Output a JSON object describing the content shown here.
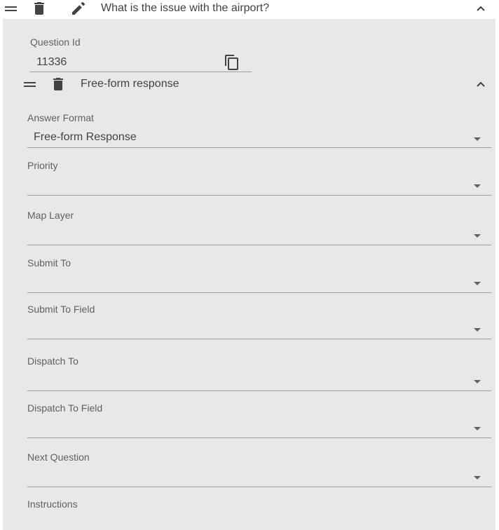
{
  "question": {
    "title": "What is the issue with the airport?",
    "question_id_label": "Question Id",
    "question_id_value": "11336"
  },
  "answer": {
    "title": "Free-form response"
  },
  "fields": {
    "answer_format": {
      "label": "Answer Format",
      "value": "Free-form Response"
    },
    "priority": {
      "label": "Priority",
      "value": ""
    },
    "map_layer": {
      "label": "Map Layer",
      "value": ""
    },
    "submit_to": {
      "label": "Submit To",
      "value": ""
    },
    "submit_to_field": {
      "label": "Submit To Field",
      "value": ""
    },
    "dispatch_to": {
      "label": "Dispatch To",
      "value": ""
    },
    "dispatch_to_field": {
      "label": "Dispatch To Field",
      "value": ""
    },
    "next_question": {
      "label": "Next Question",
      "value": ""
    },
    "instructions": {
      "label": "Instructions",
      "value": ""
    }
  },
  "icons": {
    "drag": "drag-handle-icon",
    "delete": "trash-icon",
    "edit": "pencil-icon",
    "copy": "copy-icon",
    "collapse": "chevron-up-icon",
    "dropdown": "dropdown-arrow-icon"
  },
  "colors": {
    "panel_bg": "#e8e8e8",
    "icon": "#424242",
    "underline": "#9e9e9e"
  }
}
